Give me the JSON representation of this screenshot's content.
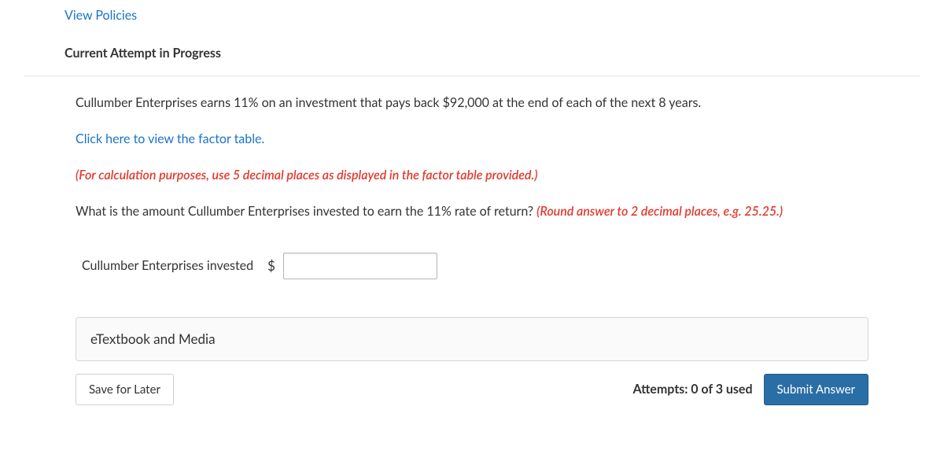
{
  "header": {
    "view_policies": "View Policies",
    "section_title": "Current Attempt in Progress"
  },
  "question": {
    "intro": "Cullumber Enterprises earns 11% on an investment that pays back $92,000 at the end of each of the next 8 years.",
    "factor_link": "Click here to view the factor table.",
    "instruction": "(For calculation purposes, use 5 decimal places as displayed in the factor table provided.)",
    "prompt_prefix": "What is the amount Cullumber Enterprises invested to earn the 11% rate of return? ",
    "prompt_hint": "(Round answer to 2 decimal places, e.g. 25.25.)",
    "answer_label": "Cullumber Enterprises invested",
    "currency_symbol": "$",
    "answer_value": ""
  },
  "resources": {
    "etextbook": "eTextbook and Media"
  },
  "actions": {
    "save_later": "Save for Later",
    "attempts": "Attempts: 0 of 3 used",
    "submit": "Submit Answer"
  }
}
